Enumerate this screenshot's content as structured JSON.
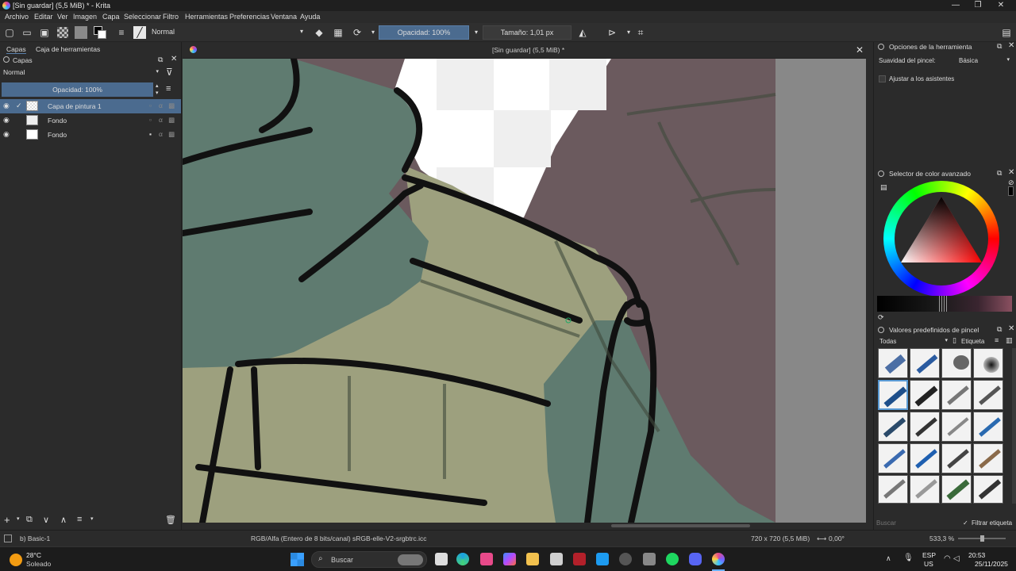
{
  "window": {
    "title": "[Sin guardar]  (5,5 MiB) * - Krita",
    "minimize": "—",
    "maximize": "❐",
    "close": "✕"
  },
  "menu": [
    "Archivo",
    "Editar",
    "Ver",
    "Imagen",
    "Capa",
    "Seleccionar",
    "Filtro",
    "Herramientas",
    "Preferencias",
    "Ventana",
    "Ayuda"
  ],
  "toolbar": {
    "blend_mode": "Normal",
    "opacity": "Opacidad: 100%",
    "size": "Tamaño: 1,01 px"
  },
  "left_dock": {
    "tabs": [
      "Capas",
      "Caja de herramientas"
    ],
    "panel_title": "Capas",
    "blend_mode": "Normal",
    "opacity": "Opacidad:  100%",
    "layers": [
      {
        "name": "Capa de pintura 1",
        "selected": true
      },
      {
        "name": "Fondo",
        "selected": false
      },
      {
        "name": "Fondo",
        "selected": false
      }
    ]
  },
  "document": {
    "title": "[Sin guardar]  (5,5 MiB) *"
  },
  "right_dock": {
    "tool_options_title": "Opciones de la herramienta",
    "smoothing_label": "Suavidad del pincel:",
    "smoothing_value": "Básica",
    "snap_label": "Ajustar a los asistentes",
    "color_selector_title": "Selector de color avanzado",
    "presets_title": "Valores predefinidos de pincel",
    "presets_filter": "Todas",
    "presets_tag": "Etiqueta",
    "search_placeholder": "Buscar",
    "filter_tag_label": "Filtrar etiqueta"
  },
  "status": {
    "brush": "b) Basic-1",
    "colorspace": "RGB/Alfa (Entero de 8 bits/canal)  sRGB-elle-V2-srgbtrc.icc",
    "dimensions": "720 x 720 (5,5 MiB)",
    "rotation": "0,00°",
    "zoom": "533,3 %"
  },
  "taskbar": {
    "temperature": "28°C",
    "weather": "Soleado",
    "search": "Buscar",
    "lang": "ESP",
    "region": "US",
    "time": "20:53",
    "date": "25/11/2025"
  },
  "colors": {
    "accent": "#4b6b8f",
    "canvas_green_dark": "#5f7b70",
    "canvas_khaki": "#9da07e",
    "canvas_mauve": "#6b5a5e"
  }
}
